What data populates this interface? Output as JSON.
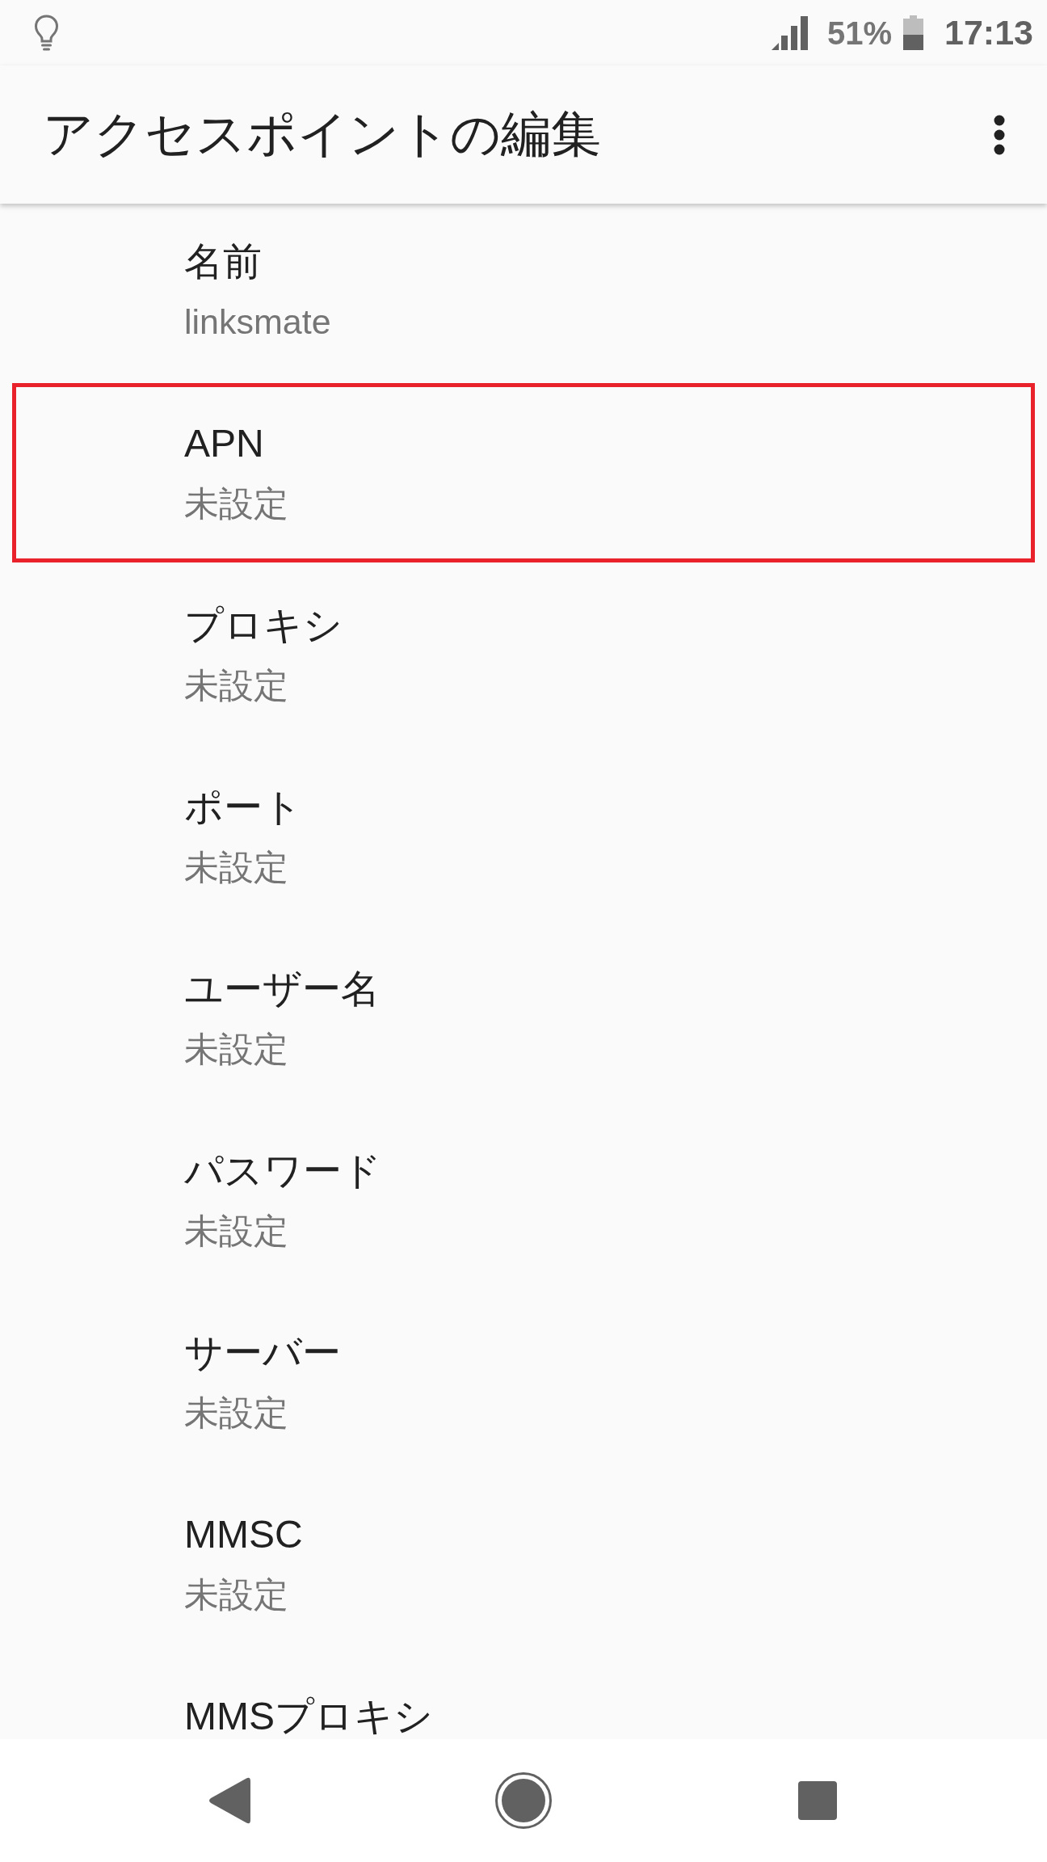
{
  "status_bar": {
    "battery": "51%",
    "time": "17:13"
  },
  "app_bar": {
    "title": "アクセスポイントの編集"
  },
  "items": [
    {
      "title": "名前",
      "summary": "linksmate",
      "highlighted": false
    },
    {
      "title": "APN",
      "summary": "未設定",
      "highlighted": true
    },
    {
      "title": "プロキシ",
      "summary": "未設定",
      "highlighted": false
    },
    {
      "title": "ポート",
      "summary": "未設定",
      "highlighted": false
    },
    {
      "title": "ユーザー名",
      "summary": "未設定",
      "highlighted": false
    },
    {
      "title": "パスワード",
      "summary": "未設定",
      "highlighted": false
    },
    {
      "title": "サーバー",
      "summary": "未設定",
      "highlighted": false
    },
    {
      "title": "MMSC",
      "summary": "未設定",
      "highlighted": false
    },
    {
      "title": "MMSプロキシ",
      "highlighted": false
    }
  ]
}
